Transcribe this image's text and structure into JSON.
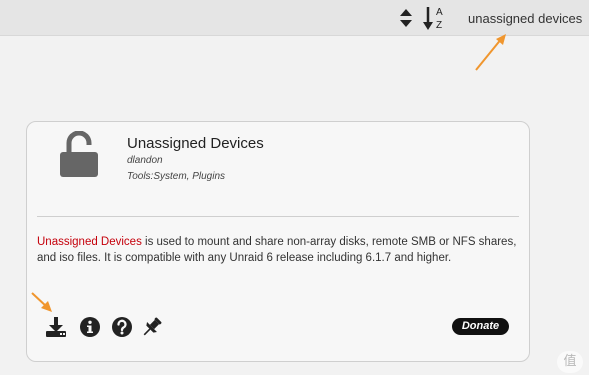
{
  "toolbar": {
    "sort_updown_icon": "sort-up-down-icon",
    "sort_az_icon": "sort-alpha-az-icon",
    "sort_az_letters": {
      "a": "A",
      "z": "Z"
    },
    "search_text": "unassigned devices"
  },
  "plugin": {
    "icon": "unlock-icon",
    "title": "Unassigned Devices",
    "author": "dlandon",
    "category": "Tools:System, Plugins",
    "description": {
      "highlight": "Unassigned Devices",
      "rest": " is used to mount and share non-array disks, remote SMB or NFS shares, and iso files. It is compatible with any Unraid 6 release including 6.1.7 and higher."
    },
    "actions": [
      {
        "name": "install",
        "icon": "download-icon"
      },
      {
        "name": "info",
        "icon": "info-icon"
      },
      {
        "name": "help",
        "icon": "question-icon"
      },
      {
        "name": "pin",
        "icon": "pin-icon"
      }
    ],
    "donate_label": "Donate"
  },
  "colors": {
    "highlight": "#c5000b",
    "arrow": "#f0962e",
    "icon": "#333333",
    "donate_bg": "#111111"
  },
  "watermark": {
    "text": "值"
  }
}
